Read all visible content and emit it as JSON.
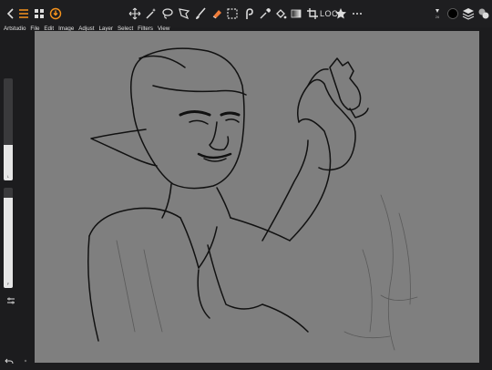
{
  "app": {
    "name": "Artstudio"
  },
  "menu": [
    {
      "id": "artstudio",
      "label": "Artstudio"
    },
    {
      "id": "file",
      "label": "File"
    },
    {
      "id": "edit",
      "label": "Edit"
    },
    {
      "id": "image",
      "label": "Image"
    },
    {
      "id": "adjust",
      "label": "Adjust"
    },
    {
      "id": "layer",
      "label": "Layer"
    },
    {
      "id": "select",
      "label": "Select"
    },
    {
      "id": "filters",
      "label": "Filters"
    },
    {
      "id": "view",
      "label": "View"
    }
  ],
  "toolbar": {
    "loc_label": "LOC",
    "icons": [
      "back-icon",
      "menu-icon",
      "grid-icon",
      "app-logo-icon",
      "move-icon",
      "magic-wand-icon",
      "lasso-icon",
      "transform-icon",
      "brush-icon",
      "eraser-icon",
      "select-rect-icon",
      "smudge-icon",
      "eyedropper-icon",
      "fill-icon",
      "gradient-icon",
      "crop-icon",
      "star-icon",
      "more-icon"
    ]
  },
  "left_panel": {
    "size_slider": {
      "value_label": "L",
      "level": 0.35
    },
    "opacity_slider": {
      "value_label": "F",
      "level": 0.9
    }
  },
  "colors": {
    "toolbar_bg": "#1e1e20",
    "canvas_bg": "#7f7f7f",
    "accent_logo": "#f7941d",
    "primary_color": "#000000"
  }
}
